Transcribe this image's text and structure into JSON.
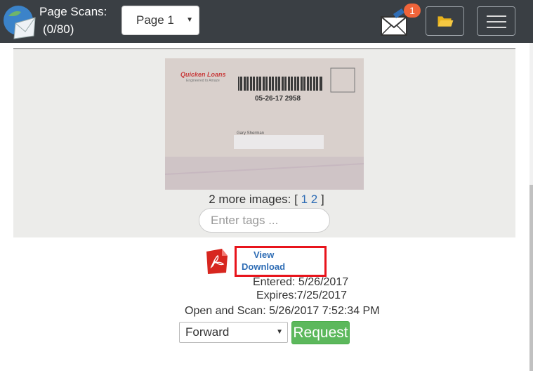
{
  "header": {
    "title": "Page Scans:",
    "count": "(0/80)",
    "page_select": "Page 1",
    "badge_count": "1"
  },
  "scan": {
    "card_brand": "Quicken Loans",
    "card_tagline": "Engineered to Amaze",
    "card_code": "05-26-17 2958",
    "card_name": "Gary Sherman",
    "more_images_prefix": "2 more images: [",
    "more_images_links": [
      "1",
      "2"
    ],
    "more_images_suffix": "]",
    "tags_placeholder": "Enter tags ..."
  },
  "document": {
    "view_label": "View",
    "download_label": "Download",
    "entered": "Entered: 5/26/2017",
    "expires": "Expires:7/25/2017",
    "open_and_scan": "Open and Scan: 5/26/2017 7:52:34 PM",
    "action_select": "Forward",
    "request_button": "Request"
  },
  "icons": {
    "logo": "globe-envelope-icon",
    "mail": "envelope-icon",
    "folder": "folder-icon",
    "menu": "hamburger-icon",
    "pdf": "pdf-icon"
  },
  "colors": {
    "topbar": "#3a3f44",
    "link": "#2f6db5",
    "highlight": "#e8141c",
    "request": "#5cb85c",
    "badge": "#f0643a"
  }
}
